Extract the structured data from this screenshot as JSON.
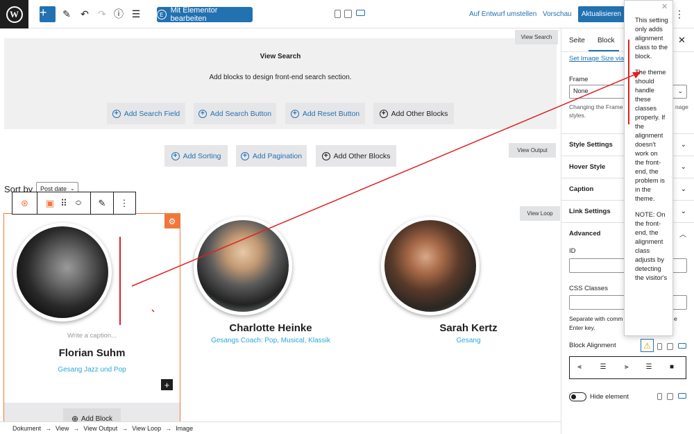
{
  "topbar": {
    "elementor_label": "Mit Elementor bearbeiten",
    "draft_label": "Auf Entwurf umstellen",
    "preview_label": "Vorschau",
    "update_label": "Aktualisieren",
    "icons": [
      "wordpress-logo-icon",
      "plus-icon",
      "pencil-icon",
      "undo-icon",
      "redo-icon",
      "info-icon",
      "list-view-icon",
      "desktop-icon",
      "tablet-icon",
      "mobile-icon",
      "more-vert-icon"
    ]
  },
  "search_section": {
    "title": "View Search",
    "subtitle": "Add blocks to design front-end search section.",
    "tag": "View Search",
    "buttons": [
      "Add Search Field",
      "Add Search Button",
      "Add Reset Button",
      "Add Other Blocks"
    ]
  },
  "output_section": {
    "tag": "View Output",
    "buttons": [
      "Add Sorting",
      "Add Pagination",
      "Add Other Blocks"
    ]
  },
  "sort": {
    "label": "Sort by",
    "selected": "Post date"
  },
  "loop_tag": "View Loop",
  "people": [
    {
      "name": "Florian Suhm",
      "role": "Gesang Jazz und Pop"
    },
    {
      "name": "Charlotte Heinke",
      "role": "Gesangs Coach: Pop, Musical, Klassik"
    },
    {
      "name": "Sarah Kertz",
      "role": "Gesang"
    }
  ],
  "caption_placeholder": "Write a caption...",
  "add_block_label": "Add Block",
  "breadcrumb": [
    "Dokument",
    "View",
    "View Output",
    "View Loop",
    "Image"
  ],
  "sidebar": {
    "tabs": [
      "Seite",
      "Block"
    ],
    "image_size_link": "Set Image Size via C",
    "frame_label": "Frame",
    "frame_value": "None",
    "frame_help_1": "Changing the Frame",
    "frame_help_2": "styles.",
    "frame_help_right": "nage",
    "sections": [
      "Style Settings",
      "Hover Style",
      "Caption",
      "Link Settings",
      "Advanced"
    ],
    "id_label": "ID",
    "css_label": "CSS Classes",
    "css_help_1": "Separate with comm",
    "css_help_2": "Enter key.",
    "css_help_right": "e",
    "block_alignment_label": "Block Alignment",
    "hide_element_label": "Hide element"
  },
  "tooltip": {
    "p1": "This setting only adds alignment class to the block.",
    "p2": "The theme should handle these classes properly. If the alignment doesn't work on the front-end, the problem is in the theme.",
    "p3": "NOTE: On the front-end, the alignment class adjusts by detecting the visitor's"
  },
  "colors": {
    "accent": "#2271b1",
    "orange": "#f0783c",
    "role_blue": "#28a8d8",
    "arrow_red": "#e02020"
  }
}
